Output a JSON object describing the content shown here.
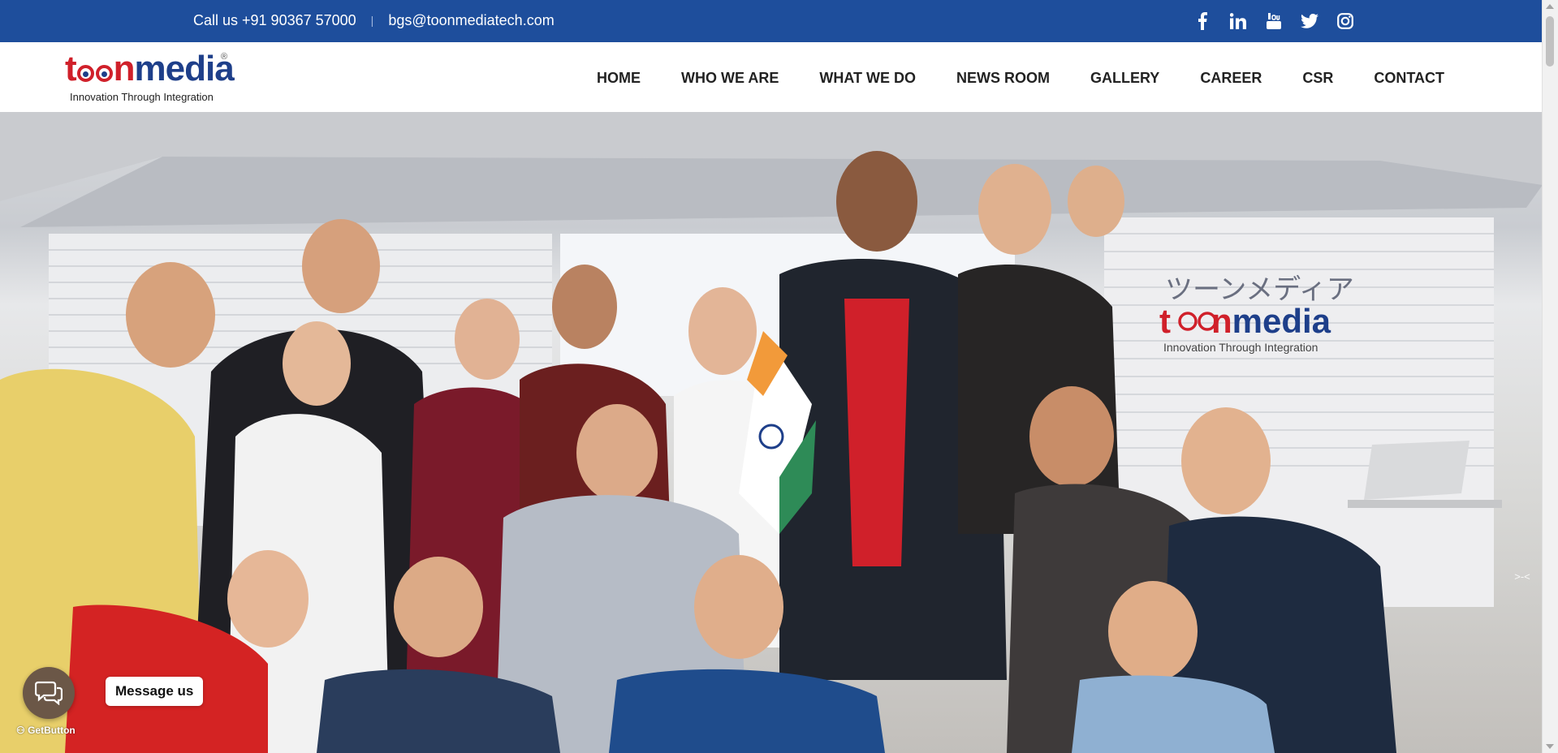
{
  "topbar": {
    "phone": "Call us +91 90367 57000",
    "separator": "|",
    "email": "bgs@toonmediatech.com",
    "social_icons": [
      "facebook-icon",
      "linkedin-icon",
      "youtube-icon",
      "twitter-icon",
      "instagram-icon"
    ],
    "background": "#1e4e9c"
  },
  "logo": {
    "brand_prefix": "t",
    "brand_mid": "n",
    "brand_suffix": "media",
    "registered": "®",
    "tagline": "Innovation Through Integration"
  },
  "nav": {
    "items": [
      {
        "label": "HOME"
      },
      {
        "label": "WHO WE ARE"
      },
      {
        "label": "WHAT WE DO"
      },
      {
        "label": "NEWS ROOM"
      },
      {
        "label": "GALLERY"
      },
      {
        "label": "CAREER"
      },
      {
        "label": "CSR"
      },
      {
        "label": "CONTACT"
      }
    ]
  },
  "hero": {
    "wall_sign_japanese": "ツーンメディア",
    "wall_sign_brand_prefix": "t",
    "wall_sign_brand_mid": "n",
    "wall_sign_brand_suffix": "media",
    "wall_sign_tagline": "Innovation Through Integration"
  },
  "chat_widget": {
    "label": "Message us",
    "powered_by": "GetButton",
    "icon": "chat-bubbles-icon",
    "color": "#6b5747"
  },
  "colors": {
    "brand_red": "#d0202a",
    "brand_blue": "#1e3f8a"
  }
}
